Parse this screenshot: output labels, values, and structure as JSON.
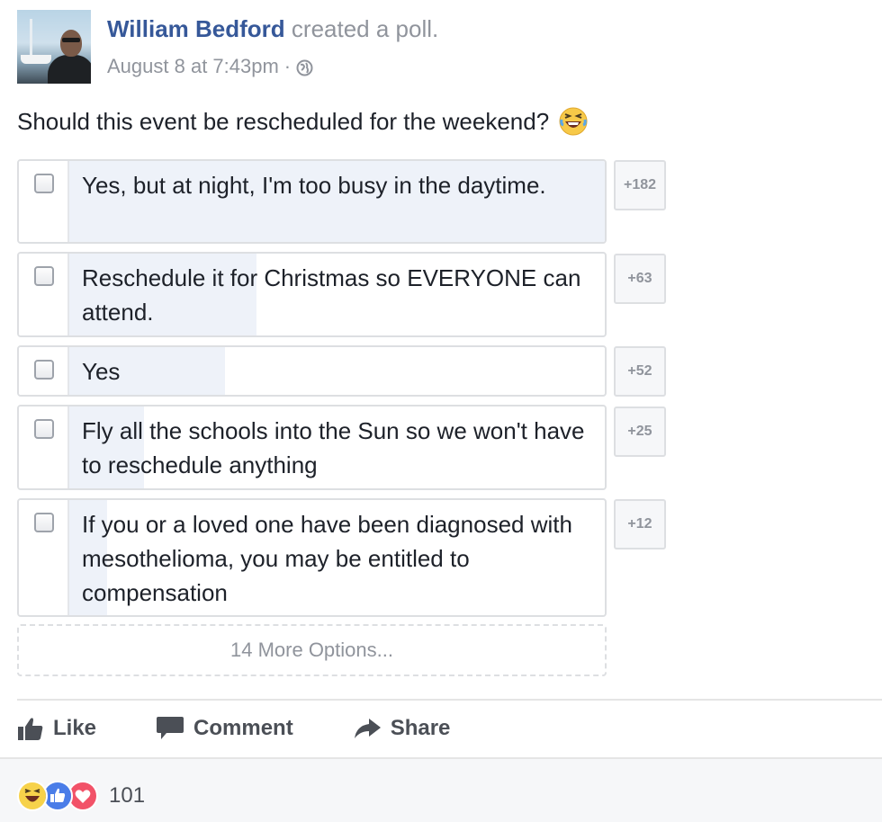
{
  "post": {
    "author": "William Bedford",
    "action": "created a poll.",
    "timestamp": "August 8 at 7:43pm",
    "separator": "·",
    "privacy_icon": "globe-icon"
  },
  "poll": {
    "question": "Should this event be rescheduled for the weekend?",
    "question_emoji": "laughing-emoji-icon",
    "options": [
      {
        "label": "Yes, but at night, I'm too busy in the daytime.",
        "votes": "+182",
        "vote_share": 1.0
      },
      {
        "label": "Reschedule it for Christmas so EVERYONE can attend.",
        "votes": "+63",
        "vote_share": 0.35
      },
      {
        "label": "Yes",
        "votes": "+52",
        "vote_share": 0.29
      },
      {
        "label": "Fly all the schools into the Sun so we won't have to reschedule anything",
        "votes": "+25",
        "vote_share": 0.14
      },
      {
        "label": "If you or a loved one have been diagnosed with mesothelioma, you may be entitled to compensation",
        "votes": "+12",
        "vote_share": 0.07
      }
    ],
    "more_options": "14 More Options..."
  },
  "actions": {
    "like": "Like",
    "comment": "Comment",
    "share": "Share"
  },
  "reactions": {
    "icons": [
      "haha-icon",
      "like-icon",
      "love-icon"
    ],
    "count": "101"
  },
  "colors": {
    "link": "#365899",
    "secondary_text": "#90949c",
    "poll_fill": "#eef2f9",
    "like_blue": "#4267b2",
    "love_red": "#f25268",
    "haha_yellow": "#f7d24a"
  }
}
